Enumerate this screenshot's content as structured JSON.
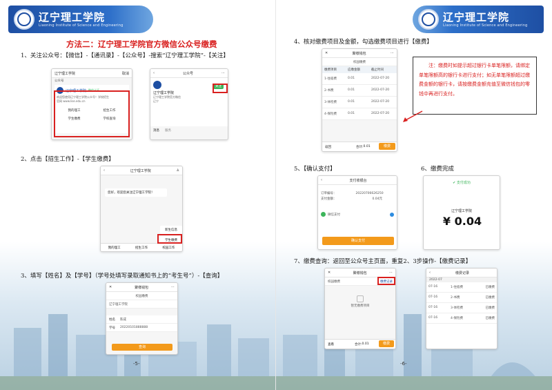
{
  "header": {
    "school_cn": "辽宁理工学院",
    "school_en": "Liaoning Institute of Science and Engineering"
  },
  "left_page": {
    "method_title": "方法二：辽宁理工学院官方微信公众号缴费",
    "step1": "1、关注公众号：【微信】-【通讯录】-【公众号】-搜索“辽宁理工学院”-【关注】",
    "step2": "2、点击【招生工作】-【学生缴费】",
    "step3": "3、填写【姓名】及【学号】（学号处填写录取通知书上的“考生号”）-【查询】",
    "page_number": "-5-",
    "screen1": {
      "search_text": "辽宁理工学院",
      "cancel": "取消",
      "section": "公众号",
      "account_name": "辽宁理工学院",
      "verified": "微信认证",
      "desc": "欢迎您使用辽宁理工学院公众号！学校招生",
      "url": "官网 www.lise.edu.cn",
      "menu": [
        "我的理工",
        "招生工作",
        "学生缴费",
        "学校查询"
      ]
    },
    "screen2": {
      "title": "公众号",
      "account_name": "辽宁理工学院",
      "follow_button": "关注",
      "desc": "辽宁理工学院官方微信",
      "location": "辽宁",
      "tabs": [
        "消息",
        "服务"
      ]
    },
    "screen3": {
      "title": "辽宁理工学院",
      "welcome": "您好，欢迎您关注辽宁理工学院！",
      "menu_items": [
        "新生信息",
        "学生缴费"
      ],
      "bottom_menu": [
        "我的理工",
        "招生工作",
        "校园工作"
      ]
    },
    "screen4": {
      "title": "聚缴钱包",
      "subtitle": "校园缴费",
      "school": "辽宁理工学院",
      "name_label": "姓名",
      "name_value": "陈成",
      "id_label": "学号",
      "id_value": "20220101888888",
      "query_button": "查询"
    }
  },
  "right_page": {
    "step4": "4、核对缴费项目及金额，勾选缴费项目进行【缴费】",
    "step5": "5、【确认支付】",
    "step6": "6、缴费完成",
    "step7": "7、缴费查询：返回至公众号主页面，重复2、3步操作-【缴费记录】",
    "page_number": "-6-",
    "note": "注：缴费时如提示超过银行卡单笔限额，请绑定单笔限额高的银行卡进行支付；如无单笔限额超过缴费金额的银行卡，请按缴费金额充值至微信钱包的零钱中再进行支付。",
    "screen_items": {
      "title": "聚缴钱包",
      "subtitle": "校园缴费",
      "headers": [
        "缴费项目",
        "应缴金额",
        "截止时间"
      ],
      "rows": [
        [
          "1-住宿费",
          "0.01",
          "2022-07-20"
        ],
        [
          "2-书费",
          "0.01",
          "2022-07-20"
        ],
        [
          "3-体检费",
          "0.01",
          "2022-07-20"
        ],
        [
          "4-保险费",
          "0.01",
          "2022-07-20"
        ]
      ],
      "footer_left": "返回",
      "total_label": "合计:",
      "total_value": "0.01",
      "pay_button": "缴费"
    },
    "screen_pay": {
      "title": "支付收银台",
      "order_label": "订单编号：",
      "order_no": "20220706626250",
      "amount_label": "支付金额：",
      "amount": "0.04元",
      "method": "微信支付",
      "confirm_button": "确认支付"
    },
    "screen_done": {
      "status": "支付成功",
      "merchant": "辽宁理工学院",
      "amount": "¥ 0.04"
    },
    "screen_query": {
      "title": "聚缴钱包",
      "subtitle": "校园缴费",
      "record_link": "缴费记录",
      "empty_text": "暂无缴费项目",
      "footer_left": "查看",
      "total_label": "合计:",
      "total_value": "0.01",
      "pay_button": "缴费"
    },
    "screen_records": {
      "title": "缴费记录",
      "month": "2022-07",
      "rows": [
        [
          "07-16",
          "1-住宿费",
          "已缴费"
        ],
        [
          "07-16",
          "2-书费",
          "已缴费"
        ],
        [
          "07-16",
          "3-体检费",
          "已缴费"
        ],
        [
          "07-16",
          "4-保险费",
          "已缴费"
        ]
      ]
    }
  },
  "colors": {
    "banner_blue": "#1e4fa3",
    "highlight_red": "#d9201f",
    "pay_orange": "#f39a1b",
    "wechat_green": "#3db55b"
  }
}
